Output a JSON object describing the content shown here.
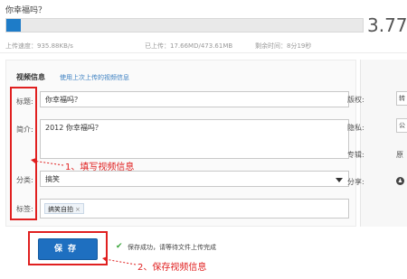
{
  "upload": {
    "filename": "你幸福吗？",
    "percent_text": "3.77%",
    "progress_fraction": 0.0377,
    "speed_label": "上传速度：935.88KB/s",
    "uploaded_label": "已上传：17.66MD/473.61MB",
    "remaining_label": "剩余时间：8分19秒"
  },
  "tabs": {
    "video_info": "视频信息",
    "use_last": "使用上次上传的视频信息"
  },
  "form": {
    "title_label": "标题:",
    "title_value": "你幸福吗？",
    "desc_label": "简介:",
    "desc_value": "2012 你幸福吗？",
    "category_label": "分类:",
    "category_value": "搞笑",
    "tags_label": "标签:",
    "tags": [
      "搞笑自拍"
    ]
  },
  "right_panel": {
    "copyright_label": "版权:",
    "copyright_value": "转",
    "privacy_label": "隐私:",
    "privacy_value": "公",
    "album_label": "专辑:",
    "album_value": "原",
    "share_label": "分享:"
  },
  "actions": {
    "save_label": "保存",
    "save_message": "保存成功，请等待文件上传完成"
  },
  "annotations": {
    "note1": "1、填写视频信息",
    "note2": "2、保存视频信息"
  },
  "colors": {
    "accent": "#1e6fc0",
    "annotation": "#e02020",
    "success": "#3aa53a",
    "link": "#3a7fc1"
  }
}
